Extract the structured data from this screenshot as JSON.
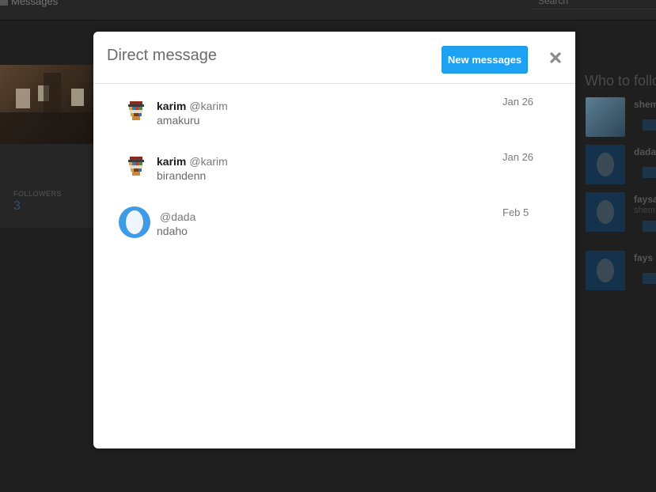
{
  "background": {
    "nav_label": "Messages",
    "search_placeholder": "Search",
    "followers_label": "FOLLOWERS",
    "followers_count": "3",
    "who_to_follow_title": "Who to follow",
    "suggestions": [
      {
        "name": "shem",
        "sub": ""
      },
      {
        "name": "dada",
        "sub": ""
      },
      {
        "name": "faysal",
        "sub": "shem"
      },
      {
        "name": "fays",
        "sub": ""
      }
    ]
  },
  "modal": {
    "title": "Direct message",
    "new_messages_label": "New messages",
    "close_icon": "close-icon"
  },
  "messages": [
    {
      "name": "karim",
      "handle": "@karim",
      "text": "amakuru",
      "date": "Jan 26",
      "avatar": "mosaic-avatar"
    },
    {
      "name": "karim",
      "handle": "@karim",
      "text": "birandenn",
      "date": "Jan 26",
      "avatar": "mosaic-avatar"
    },
    {
      "name": "",
      "handle": "@dada",
      "text": "ndaho",
      "date": "Feb 5",
      "avatar": "egg-avatar"
    }
  ],
  "colors": {
    "accent": "#1da1f2",
    "overlay": "#1f1f1f",
    "egg_avatar": "#3f9be6"
  }
}
